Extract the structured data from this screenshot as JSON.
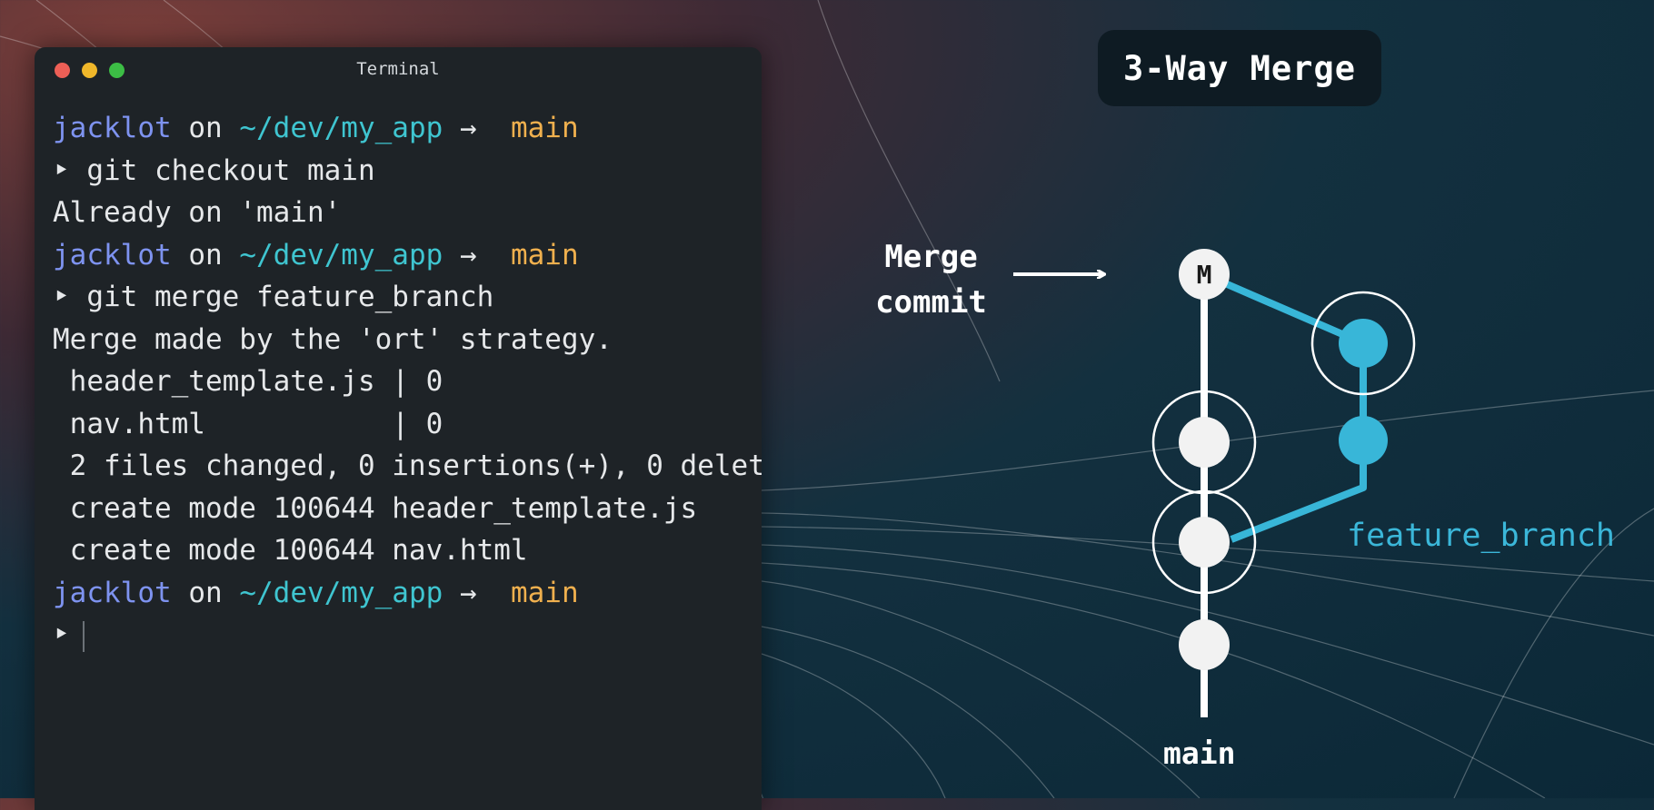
{
  "terminal": {
    "window_title": "Terminal",
    "prompt": {
      "user": "jacklot",
      "on": "on",
      "path": "~/dev/my_app",
      "arrow": "→",
      "branch_icon": "",
      "branch": "main"
    },
    "lines": [
      {
        "type": "prompt"
      },
      {
        "type": "cmd",
        "text": "git checkout main"
      },
      {
        "type": "out",
        "text": "Already on 'main'"
      },
      {
        "type": "prompt"
      },
      {
        "type": "cmd",
        "text": "git merge feature_branch"
      },
      {
        "type": "out",
        "text": "Merge made by the 'ort' strategy."
      },
      {
        "type": "out",
        "text": " header_template.js | 0"
      },
      {
        "type": "out",
        "text": " nav.html           | 0"
      },
      {
        "type": "out",
        "text": " 2 files changed, 0 insertions(+), 0 delet"
      },
      {
        "type": "out",
        "text": " create mode 100644 header_template.js"
      },
      {
        "type": "out",
        "text": " create mode 100644 nav.html"
      },
      {
        "type": "prompt"
      },
      {
        "type": "input",
        "text": ""
      }
    ],
    "cmd_marker": "‣"
  },
  "diagram": {
    "title": "3-Way Merge",
    "merge_label_line1": "Merge",
    "merge_label_line2": "commit",
    "merge_node_text": "M",
    "main_label": "main",
    "feature_label": "feature_branch",
    "colors": {
      "main": "#ffffff",
      "feature": "#38b6d8",
      "title_bg": "#0e1b23"
    }
  }
}
